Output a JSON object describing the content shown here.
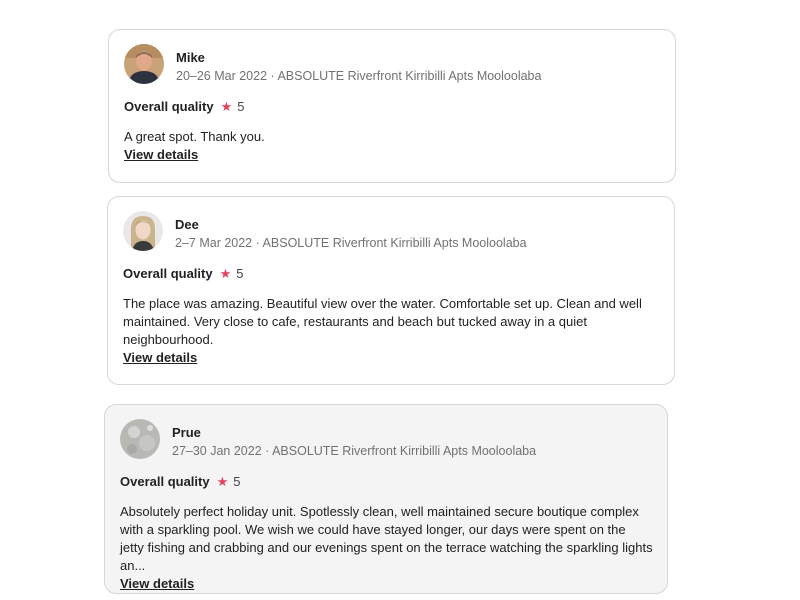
{
  "reviews": [
    {
      "name": "Mike",
      "meta": "20–26 Mar 2022 · ABSOLUTE Riverfront Kirribilli Apts Mooloolaba",
      "rating_label": "Overall quality",
      "rating_value": "5",
      "text": "A great spot. Thank you.",
      "link": "View details"
    },
    {
      "name": "Dee",
      "meta": "2–7 Mar 2022 · ABSOLUTE Riverfront Kirribilli Apts Mooloolaba",
      "rating_label": "Overall quality",
      "rating_value": "5",
      "text": "The place was amazing. Beautiful view over the water. Comfortable set up. Clean and well maintained. Very close to cafe, restaurants and beach but tucked away in a quiet neighbourhood.",
      "link": "View details"
    },
    {
      "name": "Prue",
      "meta": "27–30 Jan 2022 · ABSOLUTE Riverfront Kirribilli Apts Mooloolaba",
      "rating_label": "Overall quality",
      "rating_value": "5",
      "text": "Absolutely perfect holiday unit. Spotlessly clean, well maintained secure boutique complex with a sparkling pool. We wish we could have stayed longer, our days were spent on the jetty fishing and crabbing and our evenings spent on the terrace watching the sparkling lights an...",
      "link": "View details"
    }
  ],
  "icons": {
    "rating": "star-icon",
    "star_color": "#e3425f"
  }
}
